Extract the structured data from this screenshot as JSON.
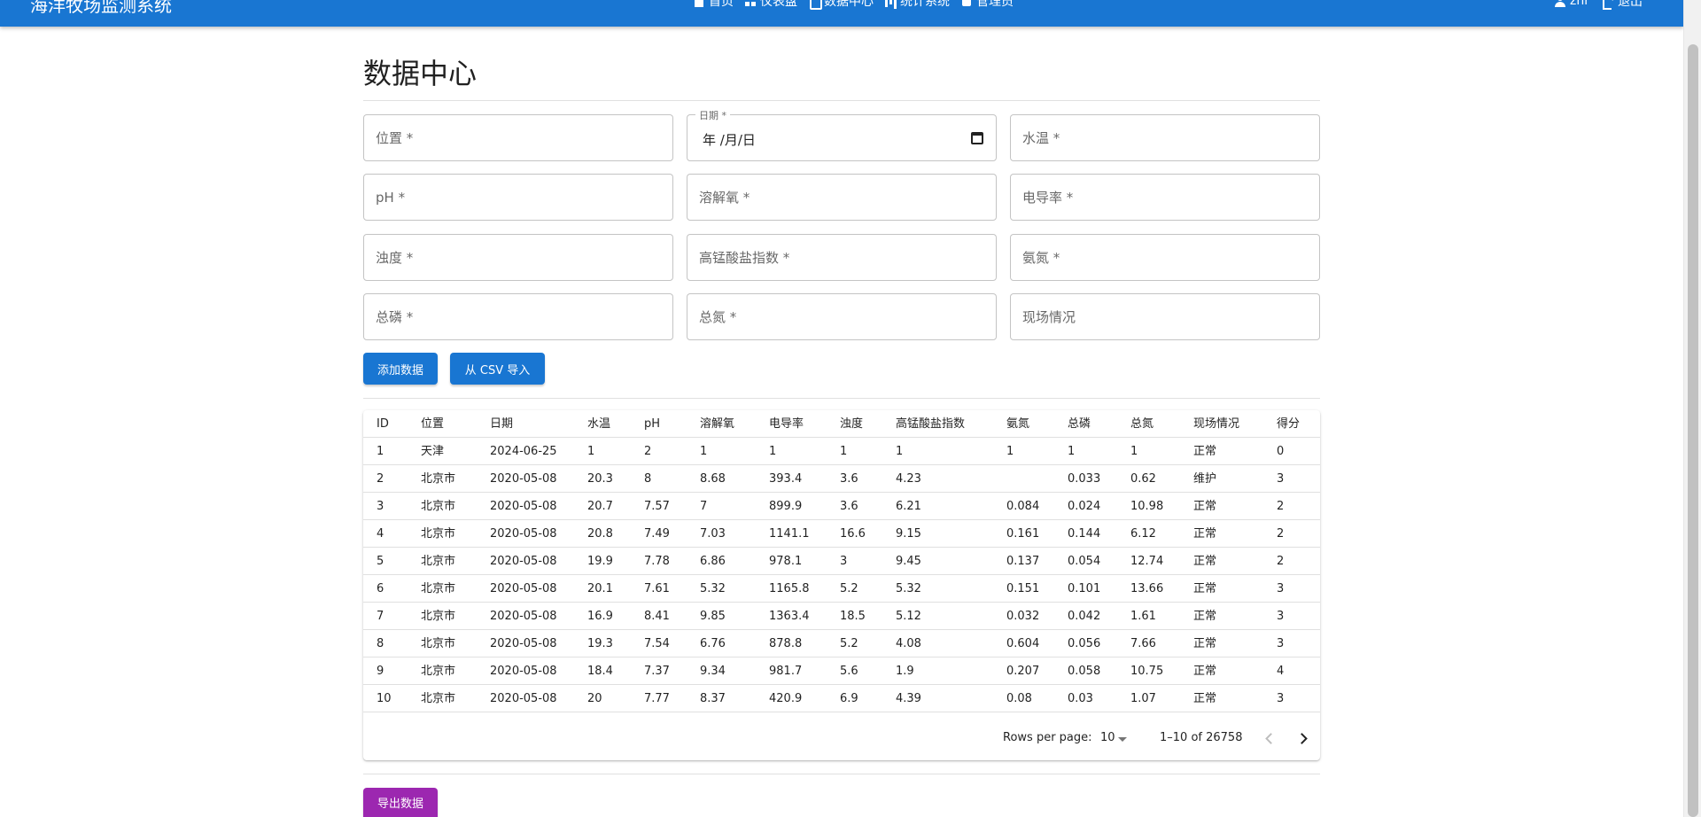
{
  "app": {
    "title": "海洋牧场监测系统",
    "nav": [
      {
        "label": "首页",
        "icon": "home-icon"
      },
      {
        "label": "仪表盘",
        "icon": "dashboard-icon"
      },
      {
        "label": "数据中心",
        "icon": "database-icon"
      },
      {
        "label": "统计系统",
        "icon": "stats-icon"
      },
      {
        "label": "管理员",
        "icon": "admin-icon"
      }
    ],
    "user_label": "zhr",
    "logout_label": "退出"
  },
  "page": {
    "title": "数据中心"
  },
  "form": {
    "location_placeholder": "位置 *",
    "date_label": "日期 *",
    "date_display": "年 /月/日",
    "water_temp_placeholder": "水温 *",
    "ph_placeholder": "pH *",
    "dissolved_oxygen_placeholder": "溶解氧 *",
    "conductivity_placeholder": "电导率 *",
    "turbidity_placeholder": "浊度 *",
    "permanganate_placeholder": "高锰酸盐指数 *",
    "ammonia_placeholder": "氨氮 *",
    "total_phosphorus_placeholder": "总磷 *",
    "total_nitrogen_placeholder": "总氮 *",
    "site_condition_placeholder": "现场情况",
    "add_button": "添加数据",
    "import_button": "从 CSV 导入"
  },
  "table": {
    "headers": [
      "ID",
      "位置",
      "日期",
      "水温",
      "pH",
      "溶解氧",
      "电导率",
      "浊度",
      "高锰酸盐指数",
      "氨氮",
      "总磷",
      "总氮",
      "现场情况",
      "得分"
    ],
    "rows": [
      [
        "1",
        "天津",
        "2024-06-25",
        "1",
        "2",
        "1",
        "1",
        "1",
        "1",
        "1",
        "1",
        "1",
        "正常",
        "0"
      ],
      [
        "2",
        "北京市",
        "2020-05-08",
        "20.3",
        "8",
        "8.68",
        "393.4",
        "3.6",
        "4.23",
        "",
        "0.033",
        "0.62",
        "维护",
        "3"
      ],
      [
        "3",
        "北京市",
        "2020-05-08",
        "20.7",
        "7.57",
        "7",
        "899.9",
        "3.6",
        "6.21",
        "0.084",
        "0.024",
        "10.98",
        "正常",
        "2"
      ],
      [
        "4",
        "北京市",
        "2020-05-08",
        "20.8",
        "7.49",
        "7.03",
        "1141.1",
        "16.6",
        "9.15",
        "0.161",
        "0.144",
        "6.12",
        "正常",
        "2"
      ],
      [
        "5",
        "北京市",
        "2020-05-08",
        "19.9",
        "7.78",
        "6.86",
        "978.1",
        "3",
        "9.45",
        "0.137",
        "0.054",
        "12.74",
        "正常",
        "2"
      ],
      [
        "6",
        "北京市",
        "2020-05-08",
        "20.1",
        "7.61",
        "5.32",
        "1165.8",
        "5.2",
        "5.32",
        "0.151",
        "0.101",
        "13.66",
        "正常",
        "3"
      ],
      [
        "7",
        "北京市",
        "2020-05-08",
        "16.9",
        "8.41",
        "9.85",
        "1363.4",
        "18.5",
        "5.12",
        "0.032",
        "0.042",
        "1.61",
        "正常",
        "3"
      ],
      [
        "8",
        "北京市",
        "2020-05-08",
        "19.3",
        "7.54",
        "6.76",
        "878.8",
        "5.2",
        "4.08",
        "0.604",
        "0.056",
        "7.66",
        "正常",
        "3"
      ],
      [
        "9",
        "北京市",
        "2020-05-08",
        "18.4",
        "7.37",
        "9.34",
        "981.7",
        "5.6",
        "1.9",
        "0.207",
        "0.058",
        "10.75",
        "正常",
        "4"
      ],
      [
        "10",
        "北京市",
        "2020-05-08",
        "20",
        "7.77",
        "8.37",
        "420.9",
        "6.9",
        "4.39",
        "0.08",
        "0.03",
        "1.07",
        "正常",
        "3"
      ]
    ]
  },
  "pagination": {
    "rows_per_page_label": "Rows per page:",
    "rows_per_page_value": "10",
    "range_text": "1–10 of 26758"
  },
  "export_button": "导出数据",
  "colors": {
    "primary": "#1976d2",
    "export": "#9c27b0"
  }
}
